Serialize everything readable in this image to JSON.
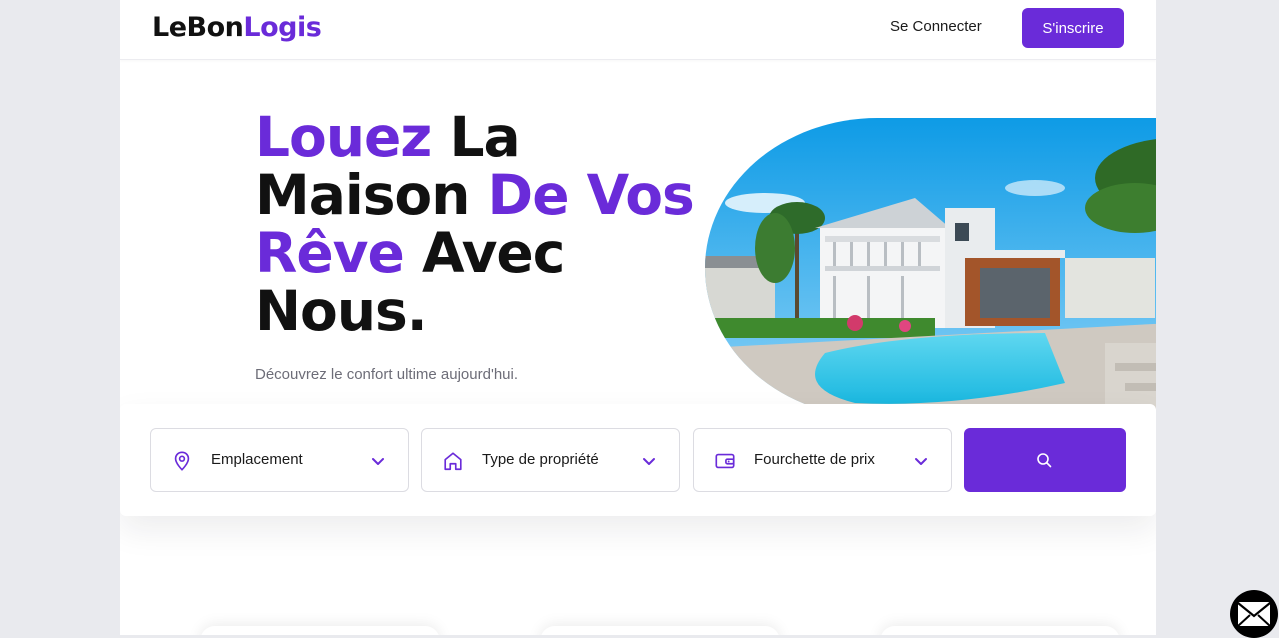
{
  "brand": {
    "part1": "LeBon",
    "part2": "Logis",
    "accent": "#6a2bd9"
  },
  "nav": {
    "signin_label": "Se Connecter",
    "signup_label": "S'inscrire"
  },
  "hero": {
    "w1": "Louez",
    "w2": "La",
    "w3": "Maison",
    "w4": "De Vos",
    "w5": "Rêve",
    "w6": "Avec",
    "w7": "Nous.",
    "subtitle": "Découvrez le confort ultime aujourd'hui."
  },
  "search": {
    "location_label": "Emplacement",
    "type_label": "Type de propriété",
    "price_label": "Fourchette de prix",
    "location_icon": "map-pin-icon",
    "type_icon": "home-icon",
    "price_icon": "wallet-icon",
    "submit_icon": "search-icon"
  }
}
